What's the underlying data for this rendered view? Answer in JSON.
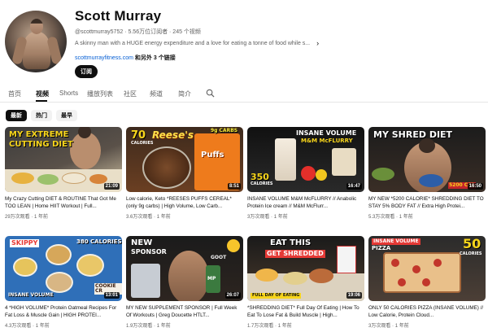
{
  "channel": {
    "name": "Scott Murray",
    "handle": "@scottmurray5752",
    "subscribers": "5.56万位订阅者",
    "video_count": "245 个视频",
    "meta_line": "@scottmurray5752 · 5.56万位订阅者 · 245 个视频",
    "description": "A skinny man with a HUGE energy expenditure and a love for eating a tonne of food while s...",
    "link_url": "scottmurrayfitness.com",
    "link_more": "和另外 3 个链接",
    "subscribe_label": "订阅"
  },
  "tabs": [
    {
      "label": "首页",
      "active": false
    },
    {
      "label": "视频",
      "active": true
    },
    {
      "label": "Shorts",
      "active": false
    },
    {
      "label": "播放列表",
      "active": false
    },
    {
      "label": "社区",
      "active": false
    },
    {
      "label": "频道",
      "active": false
    },
    {
      "label": "简介",
      "active": false
    }
  ],
  "chips": [
    {
      "label": "最新",
      "active": true
    },
    {
      "label": "热门",
      "active": false
    },
    {
      "label": "最早",
      "active": false
    }
  ],
  "videos": [
    {
      "title": "My Crazy Cutting DIET & ROUTINE That Got Me TOO LEAN | Home HIIT Workout | Full...",
      "views": "29万次观看",
      "age": "1 年前",
      "duration": "21:09",
      "overlay": [
        "MY EXTREME",
        "CUTTING DIET"
      ]
    },
    {
      "title": "Low calorie, Keto *REESES PUFFS CEREAL* (only 9g carbs) | High Volume, Low Carb...",
      "views": "3.6万次观看",
      "age": "1 年前",
      "duration": "8:51",
      "overlay": [
        "70",
        "CALORIES",
        "9g CARBS",
        "Reese's",
        "Puffs"
      ]
    },
    {
      "title": "INSANE VOLUME M&M McFLURRY // Anabolic Protein Ice cream // M&M McFlurr...",
      "views": "3万次观看",
      "age": "1 年前",
      "duration": "16:47",
      "overlay": [
        "INSANE VOLUME",
        "M&M McFLURRY",
        "350",
        "CALORIES"
      ]
    },
    {
      "title": "MY NEW *5200 CALORIE* SHREDDING DIET TO STAY 5% BODY FAT // Extra High Protei...",
      "views": "5.3万次观看",
      "age": "1 年前",
      "duration": "16:50",
      "overlay": [
        "MY SHRED DIET",
        "5200 CAL"
      ]
    },
    {
      "title": "4 *HIGH VOLUME* Protein Oatmeal Recipes For Fat Loss & Muscle Gain | HIGH PROTEI...",
      "views": "4.3万次观看",
      "age": "1 年前",
      "duration": "13:01",
      "overlay": [
        "SKIPPY",
        "380 CALORIES",
        "INSANE VOLUME",
        "COOKIE CR"
      ]
    },
    {
      "title": "MY NEW SUPPLEMENT SPONSOR | Full Week Of Workouts | Greg Doucette HTLT...",
      "views": "1.9万次观看",
      "age": "1 年前",
      "duration": "26:07",
      "overlay": [
        "NEW",
        "SPONSOR",
        "GOOT",
        "MP"
      ]
    },
    {
      "title": "*SHREDDING DIET* Full Day Of Eating | How To Eat To Lose Fat & Build Muscle | High...",
      "views": "1.7万次观看",
      "age": "1 年前",
      "duration": "19:06",
      "overlay": [
        "EAT THIS",
        "GET SHREDDED",
        "FULL DAY OF EATING"
      ]
    },
    {
      "title": "ONLY 50 CALORIES PIZZA (INSANE VOLUME) // Low Calorie, Protein Cloud...",
      "views": "3万次观看",
      "age": "1 年前",
      "duration": "",
      "overlay": [
        "INSANE VOLUME",
        "PIZZA",
        "50",
        "CALORIES"
      ]
    }
  ]
}
